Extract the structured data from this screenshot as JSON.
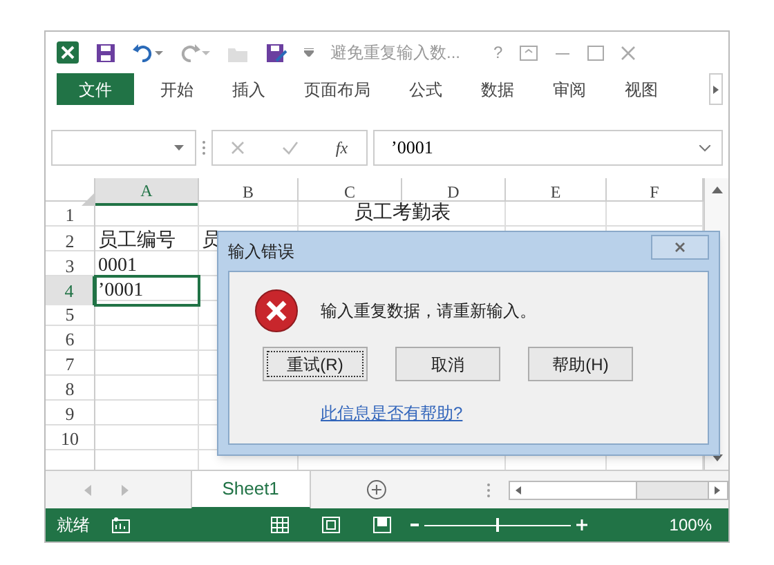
{
  "window": {
    "title": "避免重复输入数...",
    "help": "?"
  },
  "ribbon_tabs": [
    {
      "label": "文件",
      "selected": true
    },
    {
      "label": "开始",
      "selected": false
    },
    {
      "label": "插入",
      "selected": false
    },
    {
      "label": "页面布局",
      "selected": false
    },
    {
      "label": "公式",
      "selected": false
    },
    {
      "label": "数据",
      "selected": false
    },
    {
      "label": "审阅",
      "selected": false
    },
    {
      "label": "视图",
      "selected": false
    }
  ],
  "formula_bar": {
    "fx": "fx",
    "value": "’0001"
  },
  "sheet": {
    "columns": [
      {
        "label": "A",
        "selected": true
      },
      {
        "label": "B",
        "selected": false
      },
      {
        "label": "C",
        "selected": false
      },
      {
        "label": "D",
        "selected": false
      },
      {
        "label": "E",
        "selected": false
      },
      {
        "label": "F",
        "selected": false
      }
    ],
    "rows": [
      {
        "label": "1",
        "selected": false,
        "cells": [
          "",
          "",
          "员工考勤表",
          "",
          "",
          ""
        ]
      },
      {
        "label": "2",
        "selected": false,
        "cells": [
          "员工编号",
          "员",
          "",
          "",
          "",
          ""
        ]
      },
      {
        "label": "3",
        "selected": false,
        "cells": [
          "0001",
          "",
          "",
          "",
          "",
          ""
        ]
      },
      {
        "label": "4",
        "selected": true,
        "cells": [
          "’0001",
          "",
          "",
          "",
          "",
          ""
        ]
      },
      {
        "label": "5",
        "selected": false,
        "cells": [
          "",
          "",
          "",
          "",
          "",
          ""
        ]
      },
      {
        "label": "6",
        "selected": false,
        "cells": [
          "",
          "",
          "",
          "",
          "",
          ""
        ]
      },
      {
        "label": "7",
        "selected": false,
        "cells": [
          "",
          "",
          "",
          "",
          "",
          ""
        ]
      },
      {
        "label": "8",
        "selected": false,
        "cells": [
          "",
          "",
          "",
          "",
          "",
          ""
        ]
      },
      {
        "label": "9",
        "selected": false,
        "cells": [
          "",
          "",
          "",
          "",
          "",
          ""
        ]
      },
      {
        "label": "10",
        "selected": false,
        "cells": [
          "",
          "",
          "",
          "",
          "",
          ""
        ]
      }
    ]
  },
  "sheet_tabs": [
    {
      "label": "Sheet1",
      "selected": true
    }
  ],
  "status_bar": {
    "text": "就绪",
    "zoom": {
      "level": 0.5
    },
    "zoom_reading": "100%"
  },
  "dialog": {
    "title": "输入错误",
    "message": "输入重复数据，请重新输入。",
    "buttons": [
      {
        "label": "重试(R)",
        "focused": true
      },
      {
        "label": "取消",
        "focused": false
      },
      {
        "label": "帮助(H)",
        "focused": false
      }
    ],
    "link": "此信息是否有帮助?"
  }
}
